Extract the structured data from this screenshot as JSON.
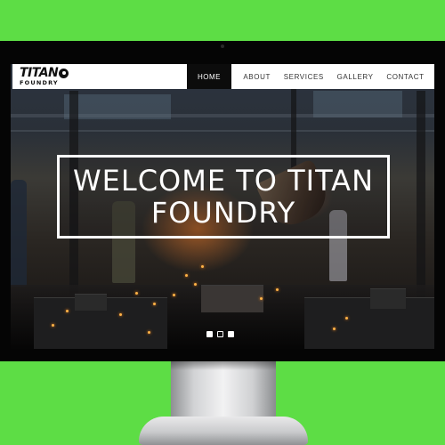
{
  "site": {
    "logo_text": "TITAN",
    "logo_sub": "FOUNDRY"
  },
  "nav": {
    "items": [
      {
        "label": "HOME",
        "active": true
      },
      {
        "label": "ABOUT",
        "active": false
      },
      {
        "label": "SERVICES",
        "active": false
      },
      {
        "label": "GALLERY",
        "active": false
      },
      {
        "label": "CONTACT",
        "active": false
      }
    ]
  },
  "hero": {
    "heading_line1": "WELCOME TO TITAN",
    "heading_line2": "FOUNDRY",
    "slide_count": 3,
    "active_slide": 1
  },
  "colors": {
    "page_background": "#5ddd45",
    "nav_active_bg": "#0c0c0c",
    "nav_bg": "#ffffff",
    "heading_border": "#ffffff"
  }
}
